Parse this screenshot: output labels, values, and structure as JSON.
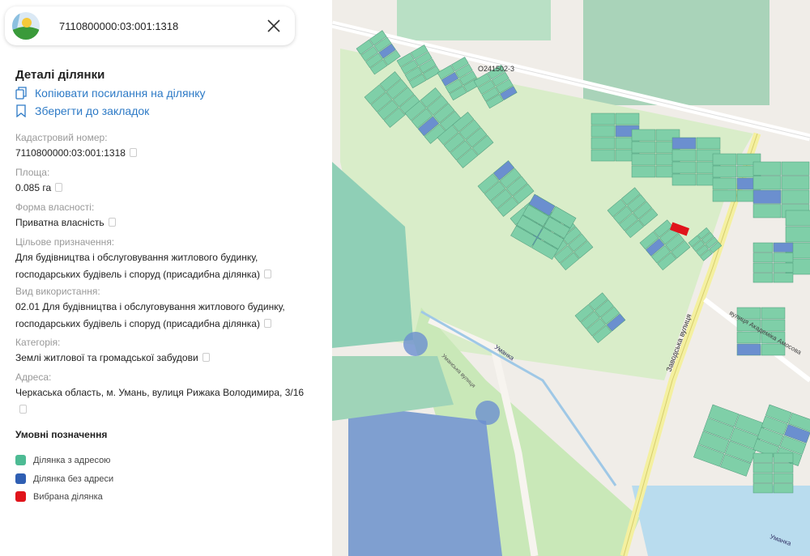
{
  "search": {
    "value": "7110800000:03:001:1318"
  },
  "details": {
    "title": "Деталі ділянки",
    "copy_link": "Копіювати посилання на ділянку",
    "bookmark": "Зберегти до закладок",
    "fields": [
      {
        "label": "Кадастровий номер:",
        "value": "7110800000:03:001:1318"
      },
      {
        "label": "Площа:",
        "value": "0.085 га"
      },
      {
        "label": "Форма власності:",
        "value": "Приватна власність"
      },
      {
        "label": "Цільове призначення:",
        "value": "Для будівництва і обслуговування житлового будинку, господарських будівель і споруд (присадибна ділянка)"
      },
      {
        "label": "Вид використання:",
        "value": "02.01 Для будівництва і обслуговування житлового будинку, господарських будівель і споруд (присадибна ділянка)"
      },
      {
        "label": "Категорія:",
        "value": "Землі житлової та громадської забудови"
      },
      {
        "label": "Адреса:",
        "value": "Черкаська область, м. Умань, вулиця Рижака Володимира, 3/16"
      }
    ]
  },
  "legend": {
    "title": "Умовні позначення",
    "items": [
      {
        "label": "Ділянка з адресою",
        "color": "#4dbb94"
      },
      {
        "label": "Ділянка без адреси",
        "color": "#2f5fb3"
      },
      {
        "label": "Вибрана ділянка",
        "color": "#e0141b"
      }
    ]
  },
  "map": {
    "labels": {
      "road_ref": "O241502-3",
      "street1": "Заводська вулиця",
      "street2": "вулиця Академіка Амосова",
      "river1": "Уманка",
      "river2": "Уманка",
      "street3": "Уманська вулиця"
    },
    "colors": {
      "parcel": "#7fcfa8",
      "parcel_noaddr": "#6b8fcf",
      "selected": "#e0141b",
      "green": "#d9edc9"
    }
  }
}
